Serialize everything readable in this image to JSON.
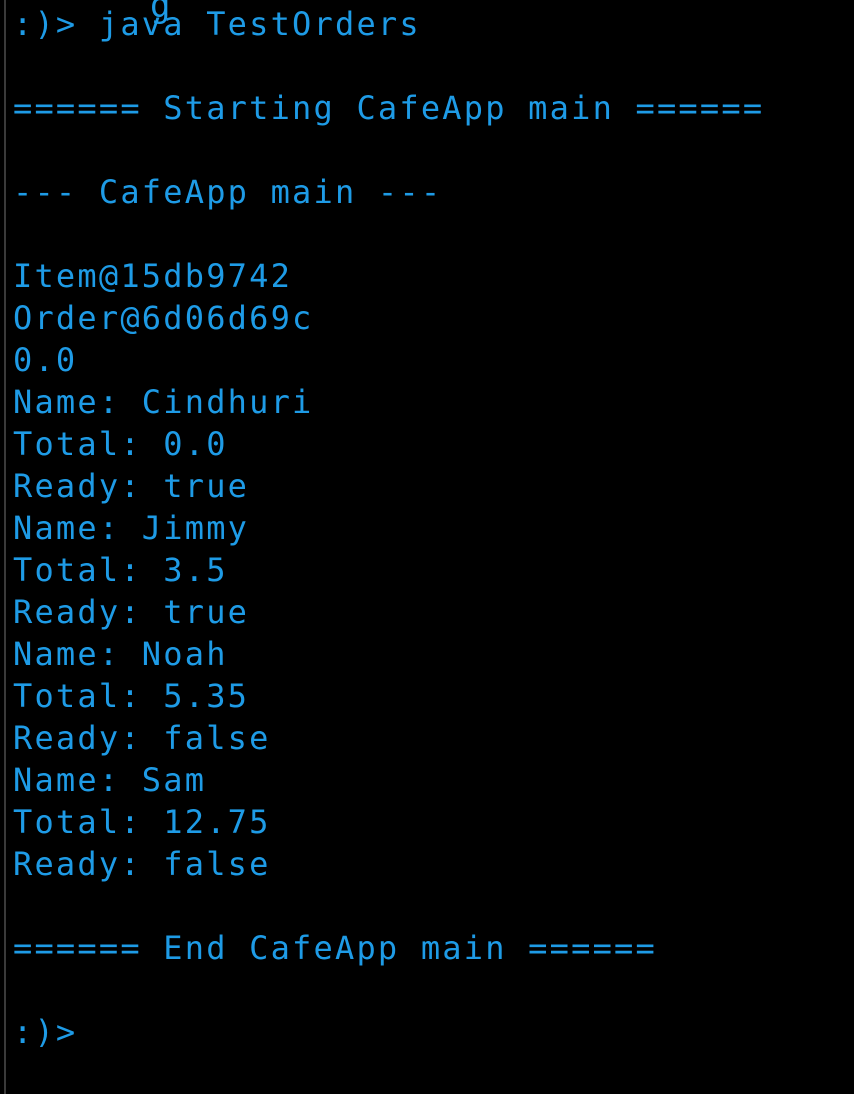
{
  "terminal": {
    "text_color": "#1e9be6",
    "background": "#000000",
    "lines": [
      ":)> java TestOrders",
      "",
      "====== Starting CafeApp main ======",
      "",
      "--- CafeApp main ---",
      "",
      "Item@15db9742",
      "Order@6d06d69c",
      "0.0",
      "Name: Cindhuri",
      "Total: 0.0",
      "Ready: true",
      "Name: Jimmy",
      "Total: 3.5",
      "Ready: true",
      "Name: Noah",
      "Total: 5.35",
      "Ready: false",
      "Name: Sam",
      "Total: 12.75",
      "Ready: false",
      "",
      "====== End CafeApp main ======",
      "",
      ":)>"
    ]
  }
}
